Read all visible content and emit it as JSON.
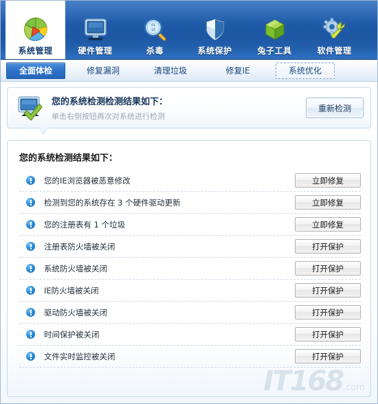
{
  "nav": {
    "items": [
      {
        "label": "系统管理",
        "icon": "pie-chart-icon",
        "active": true
      },
      {
        "label": "硬件管理",
        "icon": "monitor-icon",
        "active": false
      },
      {
        "label": "杀毒",
        "icon": "magnifier-icon",
        "active": false
      },
      {
        "label": "系统保护",
        "icon": "shield-icon",
        "active": false
      },
      {
        "label": "兔子工具",
        "icon": "green-box-icon",
        "active": false
      },
      {
        "label": "软件管理",
        "icon": "gear-wrench-icon",
        "active": false
      }
    ]
  },
  "tabs": [
    {
      "label": "全面体检",
      "state": "active"
    },
    {
      "label": "修复漏洞",
      "state": "normal"
    },
    {
      "label": "清理垃圾",
      "state": "normal"
    },
    {
      "label": "修复IE",
      "state": "normal"
    },
    {
      "label": "系统优化",
      "state": "focused"
    }
  ],
  "summary": {
    "icon": "monitor-check-icon",
    "title": "您的系统检测检测结果如下：",
    "subtitle": "单击右侧按钮再次对系统进行检测",
    "rescan_button": "重新检测"
  },
  "results": {
    "title": "您的系统检测结果如下：",
    "rows": [
      {
        "icon": "info-exclamation-icon",
        "label": "您的IE浏览器被恶意修改",
        "action": "立即修复"
      },
      {
        "icon": "info-exclamation-icon",
        "label": "检测到您的系统存在 3 个硬件驱动更新",
        "action": "立即修复"
      },
      {
        "icon": "info-exclamation-icon",
        "label": "您的注册表有 1 个垃圾",
        "action": "立即修复"
      },
      {
        "icon": "info-exclamation-icon",
        "label": "注册表防火墙被关闭",
        "action": "打开保护"
      },
      {
        "icon": "info-exclamation-icon",
        "label": "系统防火墙被关闭",
        "action": "打开保护"
      },
      {
        "icon": "info-exclamation-icon",
        "label": "IE防火墙被关闭",
        "action": "打开保护"
      },
      {
        "icon": "info-exclamation-icon",
        "label": "驱动防火墙被关闭",
        "action": "打开保护"
      },
      {
        "icon": "info-exclamation-icon",
        "label": "时间保护被关闭",
        "action": "打开保护"
      },
      {
        "icon": "info-exclamation-icon",
        "label": "文件实时监控被关闭",
        "action": "打开保护"
      }
    ]
  },
  "watermark": {
    "text": "IT168",
    "suffix": ".com"
  },
  "colors": {
    "nav_blue": "#1d57a4",
    "tab_active": "#2f72c8",
    "panel_border": "#c4d9ec",
    "info_icon": "#2e8fd8"
  }
}
